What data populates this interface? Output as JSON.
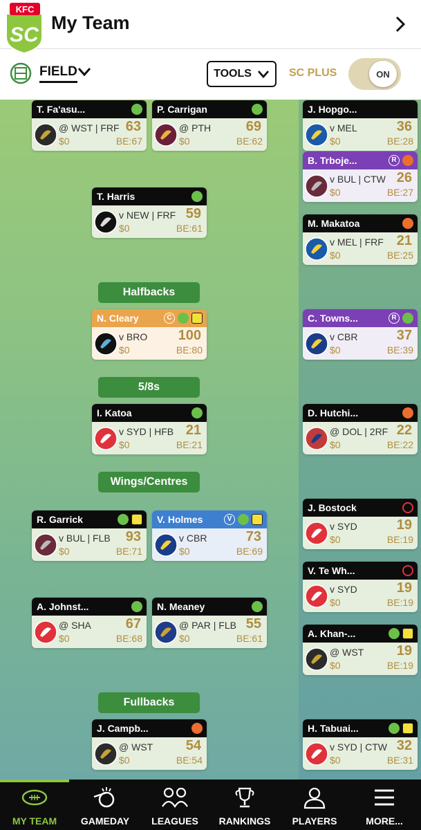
{
  "header": {
    "logo_text": "KFC SC",
    "title": "My Team"
  },
  "toolbar": {
    "field_label": "FIELD",
    "tools_label": "TOOLS",
    "sc_plus_label": "SC PLUS",
    "toggle_label": "ON"
  },
  "positions": [
    "Halfbacks",
    "5/8s",
    "Wings/Centres",
    "Fullbacks"
  ],
  "field_players": [
    {
      "name": "T. Fa'asu...",
      "fixture": "@ WST | FRF",
      "price": "$0",
      "score": "63",
      "be": "BE:67",
      "badges": [
        "ok"
      ]
    },
    {
      "name": "P. Carrigan",
      "fixture": "@ PTH",
      "price": "$0",
      "score": "69",
      "be": "BE:62",
      "badges": [
        "ok"
      ]
    },
    {
      "name": "T. Harris",
      "fixture": "v NEW | FRF",
      "price": "$0",
      "score": "59",
      "be": "BE:61",
      "badges": [
        "ok"
      ]
    },
    {
      "name": "N. Cleary",
      "fixture": "v BRO",
      "price": "$0",
      "score": "100",
      "be": "BE:80",
      "badges": [
        "C",
        "ok",
        "warn"
      ]
    },
    {
      "name": "I. Katoa",
      "fixture": "v SYD | HFB",
      "price": "$0",
      "score": "21",
      "be": "BE:21",
      "badges": [
        "ok"
      ]
    },
    {
      "name": "R. Garrick",
      "fixture": "v BUL | FLB",
      "price": "$0",
      "score": "93",
      "be": "BE:71",
      "badges": [
        "ok",
        "warn"
      ]
    },
    {
      "name": "V. Holmes",
      "fixture": "v CBR",
      "price": "$0",
      "score": "73",
      "be": "BE:69",
      "badges": [
        "V",
        "ok",
        "warn"
      ]
    },
    {
      "name": "A. Johnst...",
      "fixture": "@ SHA",
      "price": "$0",
      "score": "67",
      "be": "BE:68",
      "badges": [
        "ok"
      ]
    },
    {
      "name": "N. Meaney",
      "fixture": "@ PAR | FLB",
      "price": "$0",
      "score": "55",
      "be": "BE:61",
      "badges": [
        "ok"
      ]
    },
    {
      "name": "J. Campb...",
      "fixture": "@ WST",
      "price": "$0",
      "score": "54",
      "be": "BE:54",
      "badges": [
        "inj"
      ]
    }
  ],
  "bench_players": [
    {
      "name": "J. Hopgo...",
      "fixture": "v MEL",
      "price": "$0",
      "score": "36",
      "be": "BE:28",
      "badges": []
    },
    {
      "name": "B. Trboje...",
      "fixture": "v BUL | CTW",
      "price": "$0",
      "score": "26",
      "be": "BE:27",
      "badges": [
        "R",
        "inj"
      ]
    },
    {
      "name": "M. Makatoa",
      "fixture": "v MEL | FRF",
      "price": "$0",
      "score": "21",
      "be": "BE:25",
      "badges": [
        "inj"
      ]
    },
    {
      "name": "C. Towns...",
      "fixture": "v CBR",
      "price": "$0",
      "score": "37",
      "be": "BE:39",
      "badges": [
        "R",
        "ok"
      ]
    },
    {
      "name": "D. Hutchi...",
      "fixture": "@ DOL | 2RF",
      "price": "$0",
      "score": "22",
      "be": "BE:22",
      "badges": [
        "inj"
      ]
    },
    {
      "name": "J. Bostock",
      "fixture": "v SYD",
      "price": "$0",
      "score": "19",
      "be": "BE:19",
      "badges": [
        "ring"
      ]
    },
    {
      "name": "V. Te Wh...",
      "fixture": "v SYD",
      "price": "$0",
      "score": "19",
      "be": "BE:19",
      "badges": [
        "ring"
      ]
    },
    {
      "name": "A. Khan-...",
      "fixture": "@ WST",
      "price": "$0",
      "score": "19",
      "be": "BE:19",
      "badges": [
        "ok",
        "warn"
      ]
    },
    {
      "name": "H. Tabuai...",
      "fixture": "v SYD | CTW",
      "price": "$0",
      "score": "32",
      "be": "BE:31",
      "badges": [
        "ok",
        "warn"
      ]
    }
  ],
  "nav": [
    {
      "label": "MY TEAM",
      "icon": "football-icon",
      "active": true
    },
    {
      "label": "GAMEDAY",
      "icon": "whistle-icon",
      "active": false
    },
    {
      "label": "LEAGUES",
      "icon": "versus-icon",
      "active": false
    },
    {
      "label": "RANKINGS",
      "icon": "trophy-icon",
      "active": false
    },
    {
      "label": "PLAYERS",
      "icon": "player-icon",
      "active": false
    },
    {
      "label": "MORE...",
      "icon": "menu-icon",
      "active": false
    }
  ],
  "colors": {
    "accent_green": "#8dc73f",
    "gold": "#b08d3f",
    "captain": "#eaa44c",
    "vice_captain": "#3f7fd0",
    "reserve": "#7b40b5",
    "position_pill": "#3c8d3e"
  }
}
